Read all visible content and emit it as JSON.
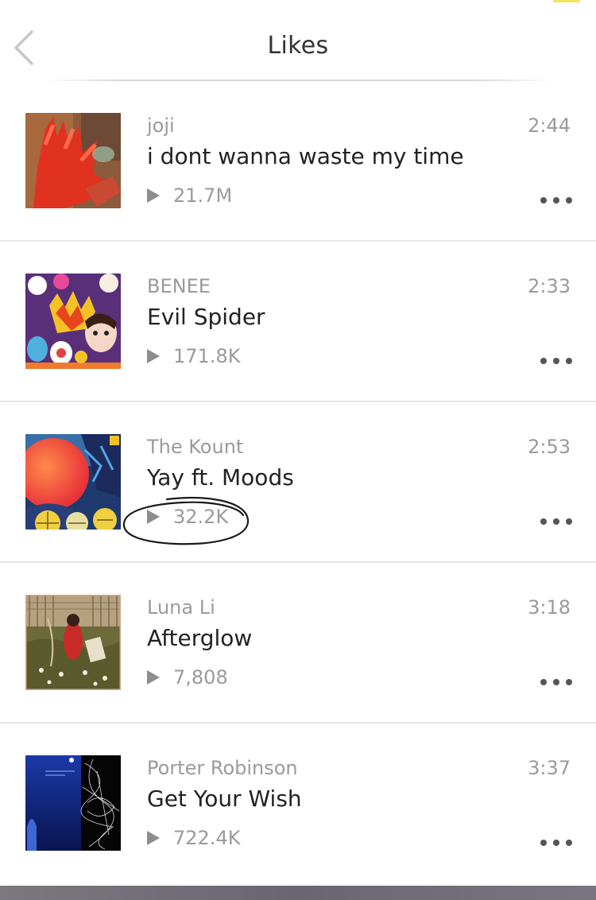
{
  "header": {
    "title": "Likes",
    "back_icon": "chevron-left-icon"
  },
  "tracks": [
    {
      "artist": "joji",
      "title": "i dont wanna waste my time",
      "plays": "21.7M",
      "duration": "2:44",
      "artwork": "red-hand-artwork"
    },
    {
      "artist": "BENEE",
      "title": "Evil Spider",
      "plays": "171.8K",
      "duration": "2:33",
      "artwork": "colorful-crowd-artwork"
    },
    {
      "artist": "The Kount",
      "title": "Yay ft. Moods",
      "plays": "32.2K",
      "duration": "2:53",
      "artwork": "sunset-collage-artwork"
    },
    {
      "artist": "Luna Li",
      "title": "Afterglow",
      "plays": "7,808",
      "duration": "3:18",
      "artwork": "field-portrait-artwork",
      "annotated": true
    },
    {
      "artist": "Porter Robinson",
      "title": "Get Your Wish",
      "plays": "722.4K",
      "duration": "3:37",
      "artwork": "blue-night-artwork"
    }
  ],
  "colors": {
    "secondary_text": "#9a9a9a",
    "primary_text": "#222222",
    "divider": "#e7e7e7",
    "accent": "#f3e65a"
  }
}
